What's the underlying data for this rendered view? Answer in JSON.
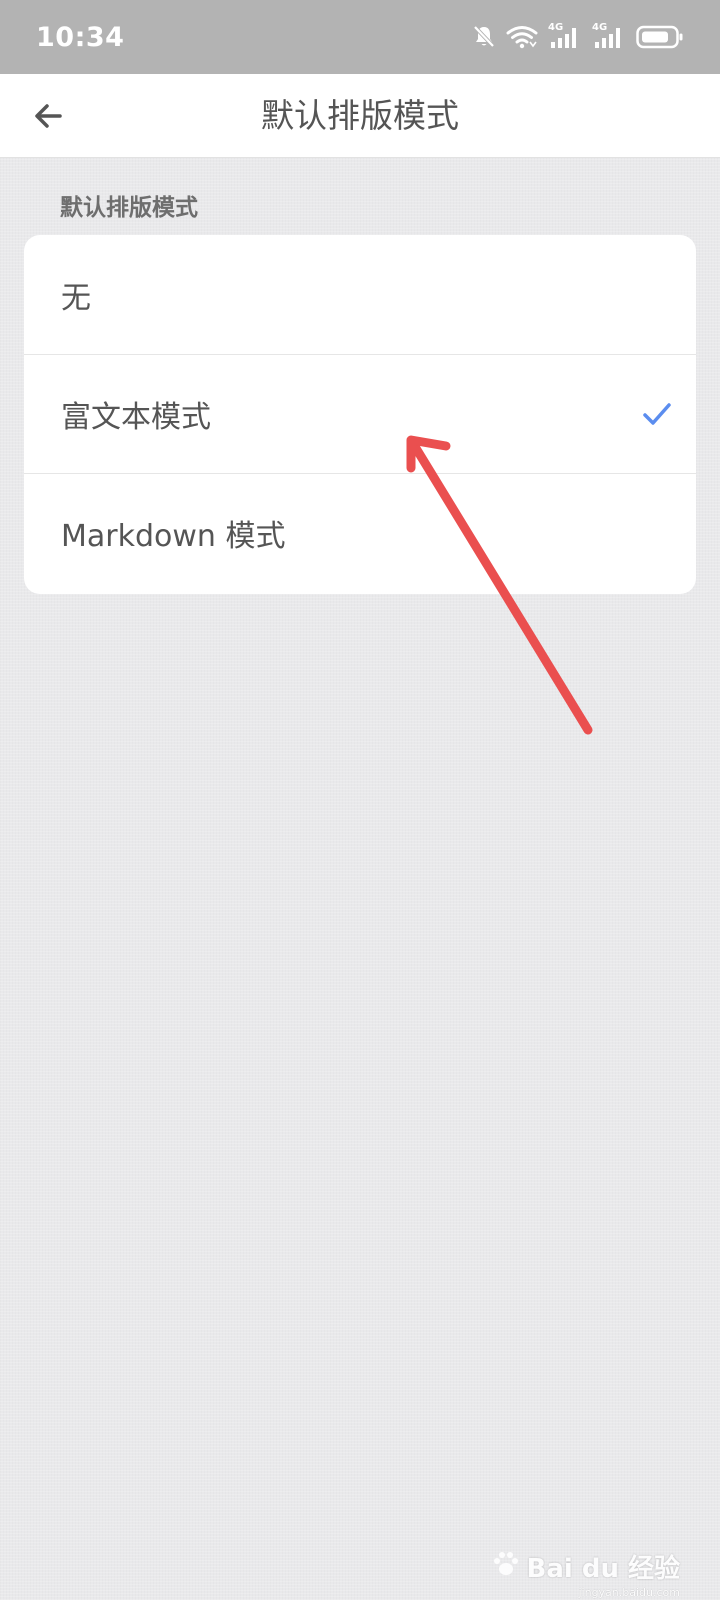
{
  "status_bar": {
    "time": "10:34",
    "icons": [
      "bell-off-icon",
      "wifi-icon",
      "signal-4g-icon",
      "signal-4g-icon",
      "battery-icon"
    ],
    "network_label_1": "4G",
    "network_label_2": "4G"
  },
  "app_bar": {
    "back_icon": "arrow-left-icon",
    "title": "默认排版模式"
  },
  "section": {
    "header": "默认排版模式"
  },
  "options": [
    {
      "label": "无",
      "selected": false
    },
    {
      "label": "富文本模式",
      "selected": true
    },
    {
      "label": "Markdown 模式",
      "selected": false
    }
  ],
  "colors": {
    "accent_check": "#5b8def",
    "annotation_arrow": "#ea4f4f",
    "status_bar_bg": "#b3b3b3",
    "page_bg": "#e9e9eb"
  },
  "watermark": {
    "text": "Bai du 经验",
    "sub": "jingyan.baidu.com"
  }
}
